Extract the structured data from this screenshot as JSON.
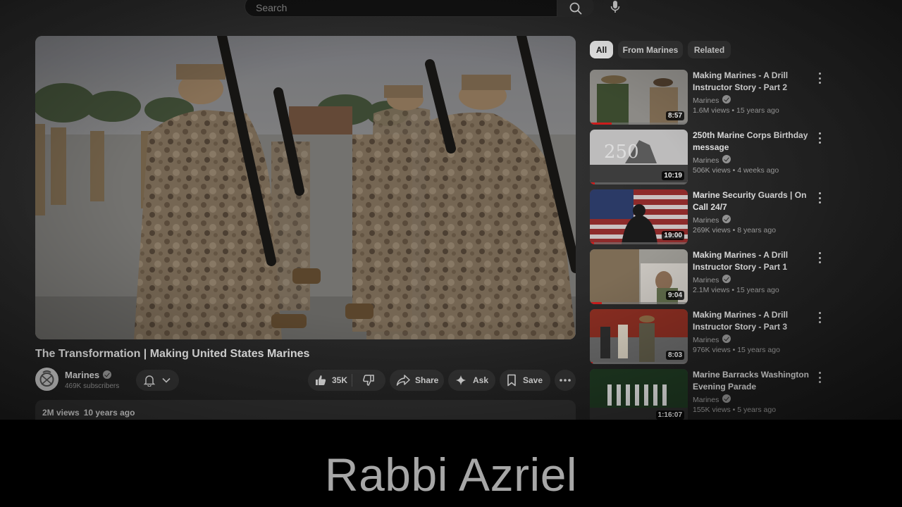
{
  "search": {
    "placeholder": "Search"
  },
  "video": {
    "title": "The Transformation | Making United States Marines",
    "channel": "Marines",
    "subscribers": "469K subscribers",
    "likes": "35K",
    "share_label": "Share",
    "ask_label": "Ask",
    "save_label": "Save",
    "views": "2M views",
    "age": "10 years ago"
  },
  "chips": [
    {
      "label": "All",
      "active": true
    },
    {
      "label": "From Marines",
      "active": false
    },
    {
      "label": "Related",
      "active": false
    }
  ],
  "related": [
    {
      "title": "Making Marines - A Drill Instructor Story - Part 2",
      "channel": "Marines",
      "meta": "1.6M views • 15 years ago",
      "duration": "8:57",
      "watched": 0.22
    },
    {
      "title": "250th Marine Corps Birthday message",
      "channel": "Marines",
      "meta": "506K views • 4 weeks ago",
      "duration": "10:19",
      "watched": 0.05
    },
    {
      "title": "Marine Security Guards | On Call 24/7",
      "channel": "Marines",
      "meta": "269K views • 8 years ago",
      "duration": "19:00",
      "watched": 0.04
    },
    {
      "title": "Making Marines - A Drill Instructor Story - Part 1",
      "channel": "Marines",
      "meta": "2.1M views • 15 years ago",
      "duration": "9:04",
      "watched": 0.12
    },
    {
      "title": "Making Marines - A Drill Instructor Story - Part 3",
      "channel": "Marines",
      "meta": "976K views • 15 years ago",
      "duration": "8:03",
      "watched": 0.03
    },
    {
      "title": "Marine Barracks Washington Evening Parade",
      "channel": "Marines",
      "meta": "155K views • 5 years ago",
      "duration": "1:16:07",
      "watched": 0.0
    }
  ],
  "caption": "Rabbi Azriel"
}
